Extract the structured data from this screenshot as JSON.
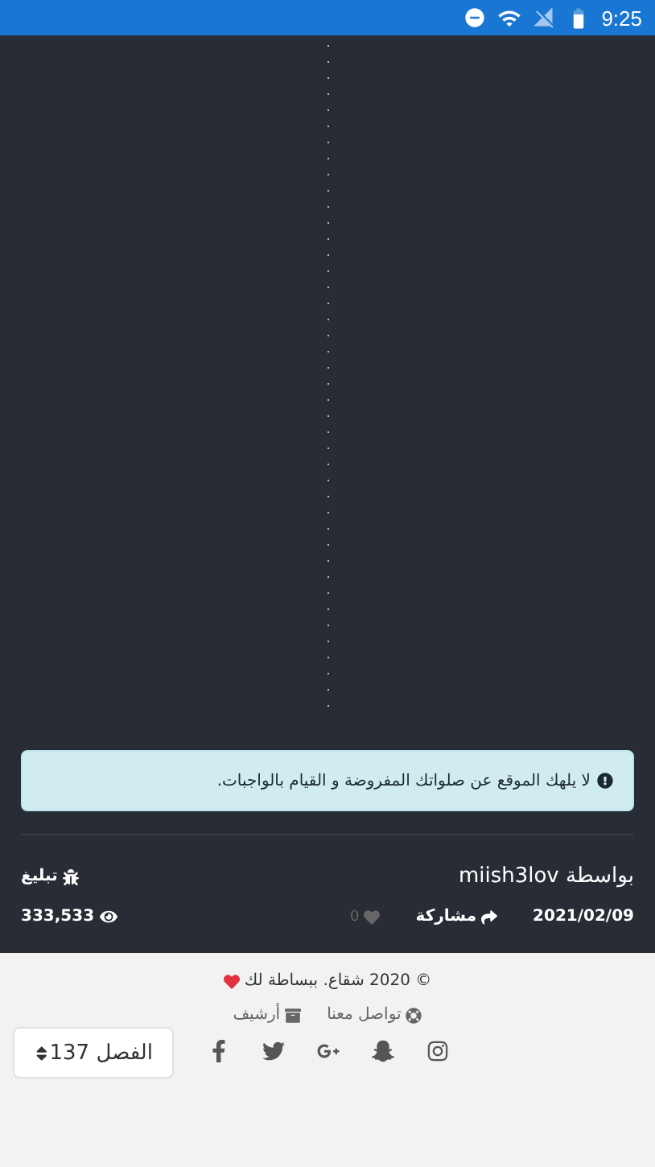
{
  "status_bar": {
    "time": "9:25"
  },
  "notice": {
    "text": "لا يلهك الموقع عن صلواتك المفروضة و القيام بالواجبات."
  },
  "post": {
    "author_prefix": "بواسطة",
    "author": "miish3lov",
    "report": "تبليغ",
    "date": "2021/02/09",
    "share": "مشاركة",
    "likes": "0",
    "liked": false,
    "views": "333,533"
  },
  "footer": {
    "copyright": "© 2020 شقاع. ببساطة لك",
    "links": [
      {
        "label": "تواصل معنا",
        "kind": "contact"
      },
      {
        "label": "أرشيف",
        "kind": "archive"
      }
    ],
    "social": [
      {
        "kind": "facebook"
      },
      {
        "kind": "twitter"
      },
      {
        "kind": "googleplus"
      },
      {
        "kind": "snapchat"
      },
      {
        "kind": "instagram"
      }
    ]
  },
  "chapter_select": {
    "value": "الفصل 137"
  }
}
